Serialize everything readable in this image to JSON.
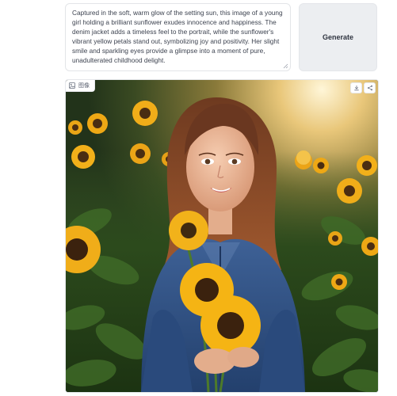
{
  "prompt": {
    "value": "Captured in the soft, warm glow of the setting sun, this image of a young girl holding a brilliant sunflower exudes innocence and happiness. The denim jacket adds a timeless feel to the portrait, while the sunflower's vibrant yellow petals stand out, symbolizing joy and positivity. Her slight smile and sparkling eyes provide a glimpse into a moment of pure, unadulterated childhood delight."
  },
  "generate_button": {
    "label": "Generate"
  },
  "output_image": {
    "label": "图像",
    "label_icon": "image-icon",
    "actions": [
      "download-icon",
      "share-icon"
    ]
  },
  "colors": {
    "border": "#e3e5e8",
    "button_bg": "#eceef1",
    "petal": "#f5b414",
    "denim": "#2f4e80",
    "hair": "#7a3f22",
    "foliage": "#2e4a1f"
  }
}
